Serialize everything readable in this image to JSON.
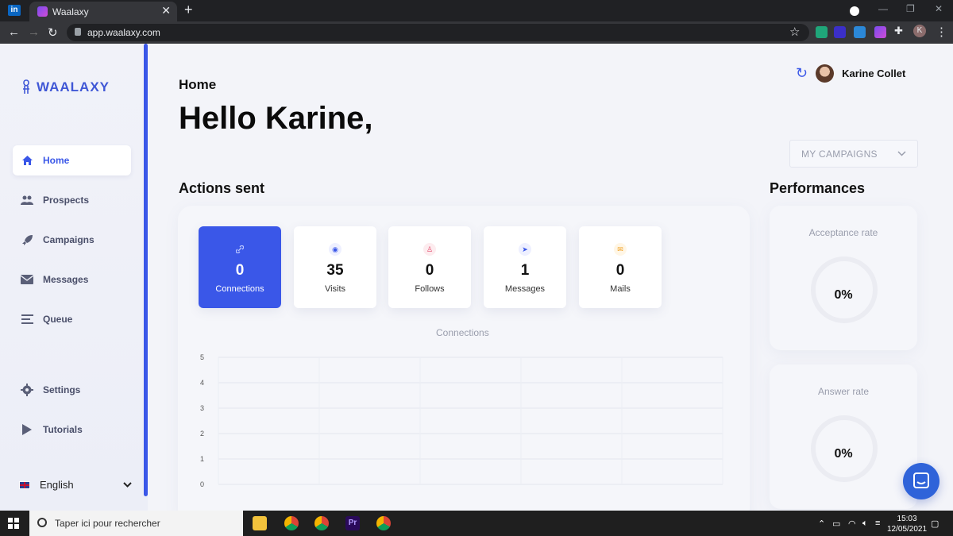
{
  "browser": {
    "tab_title": "Waalaxy",
    "tab_close": "✕",
    "new_tab": "+",
    "url": "app.waalaxy.com",
    "profile_initial": "K"
  },
  "sidebar": {
    "logo": "WAALAXY",
    "items": [
      {
        "label": "Home",
        "icon": "home-icon",
        "active": true
      },
      {
        "label": "Prospects",
        "icon": "people-icon"
      },
      {
        "label": "Campaigns",
        "icon": "rocket-icon"
      },
      {
        "label": "Messages",
        "icon": "envelope-icon"
      },
      {
        "label": "Queue",
        "icon": "queue-icon"
      },
      {
        "label": "Settings",
        "icon": "gear-icon"
      },
      {
        "label": "Tutorials",
        "icon": "play-icon"
      }
    ],
    "language": "English"
  },
  "header": {
    "breadcrumb": "Home",
    "greeting": "Hello Karine,",
    "user_name": "Karine Collet"
  },
  "campaign_select": {
    "value": "MY CAMPAIGNS"
  },
  "actions": {
    "title": "Actions sent",
    "stats": [
      {
        "value": "0",
        "label": "Connections",
        "icon": "link-icon",
        "color": "#8fa2f2"
      },
      {
        "value": "35",
        "label": "Visits",
        "icon": "eye-icon",
        "color": "#3a57e8"
      },
      {
        "value": "0",
        "label": "Follows",
        "icon": "user-icon",
        "color": "#e24a6c"
      },
      {
        "value": "1",
        "label": "Messages",
        "icon": "send-icon",
        "color": "#3a57e8"
      },
      {
        "value": "0",
        "label": "Mails",
        "icon": "mail-icon",
        "color": "#f0a020"
      }
    ]
  },
  "chart_data": {
    "type": "line",
    "title": "Connections",
    "x": [],
    "series": [
      {
        "values": []
      }
    ],
    "ylim": [
      0,
      5
    ],
    "yticks": [
      "0",
      "1",
      "2",
      "3",
      "4",
      "5"
    ],
    "grid": true
  },
  "performances": {
    "title": "Performances",
    "cards": [
      {
        "label": "Acceptance rate",
        "value": "0%"
      },
      {
        "label": "Answer rate",
        "value": "0%"
      }
    ]
  },
  "taskbar": {
    "search_placeholder": "Taper ici pour rechercher",
    "time": "15:03",
    "date": "12/05/2021"
  },
  "colors": {
    "accent": "#3a57e8",
    "background": "#f3f4f9"
  }
}
